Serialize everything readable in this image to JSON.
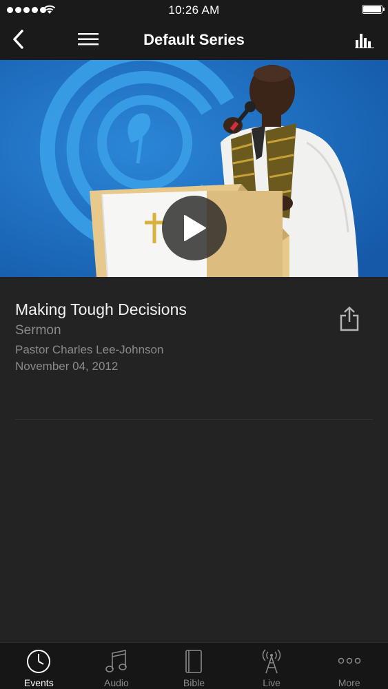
{
  "status_bar": {
    "time": "10:26 AM"
  },
  "nav": {
    "title": "Default Series"
  },
  "event": {
    "title": "Making Tough Decisions",
    "type": "Sermon",
    "speaker": "Pastor Charles Lee-Johnson",
    "date": "November 04, 2012"
  },
  "tabs": [
    {
      "label": "Events",
      "icon": "clock-icon",
      "active": true
    },
    {
      "label": "Audio",
      "icon": "music-note-icon",
      "active": false
    },
    {
      "label": "Bible",
      "icon": "book-icon",
      "active": false
    },
    {
      "label": "Live",
      "icon": "broadcast-tower-icon",
      "active": false
    },
    {
      "label": "More",
      "icon": "more-dots-icon",
      "active": false
    }
  ],
  "colors": {
    "background": "#222223",
    "bar": "#1a1a1b",
    "tab_bar": "#161617",
    "secondary_text": "#8a8a8c",
    "video_blue": "#1f6fc2"
  }
}
